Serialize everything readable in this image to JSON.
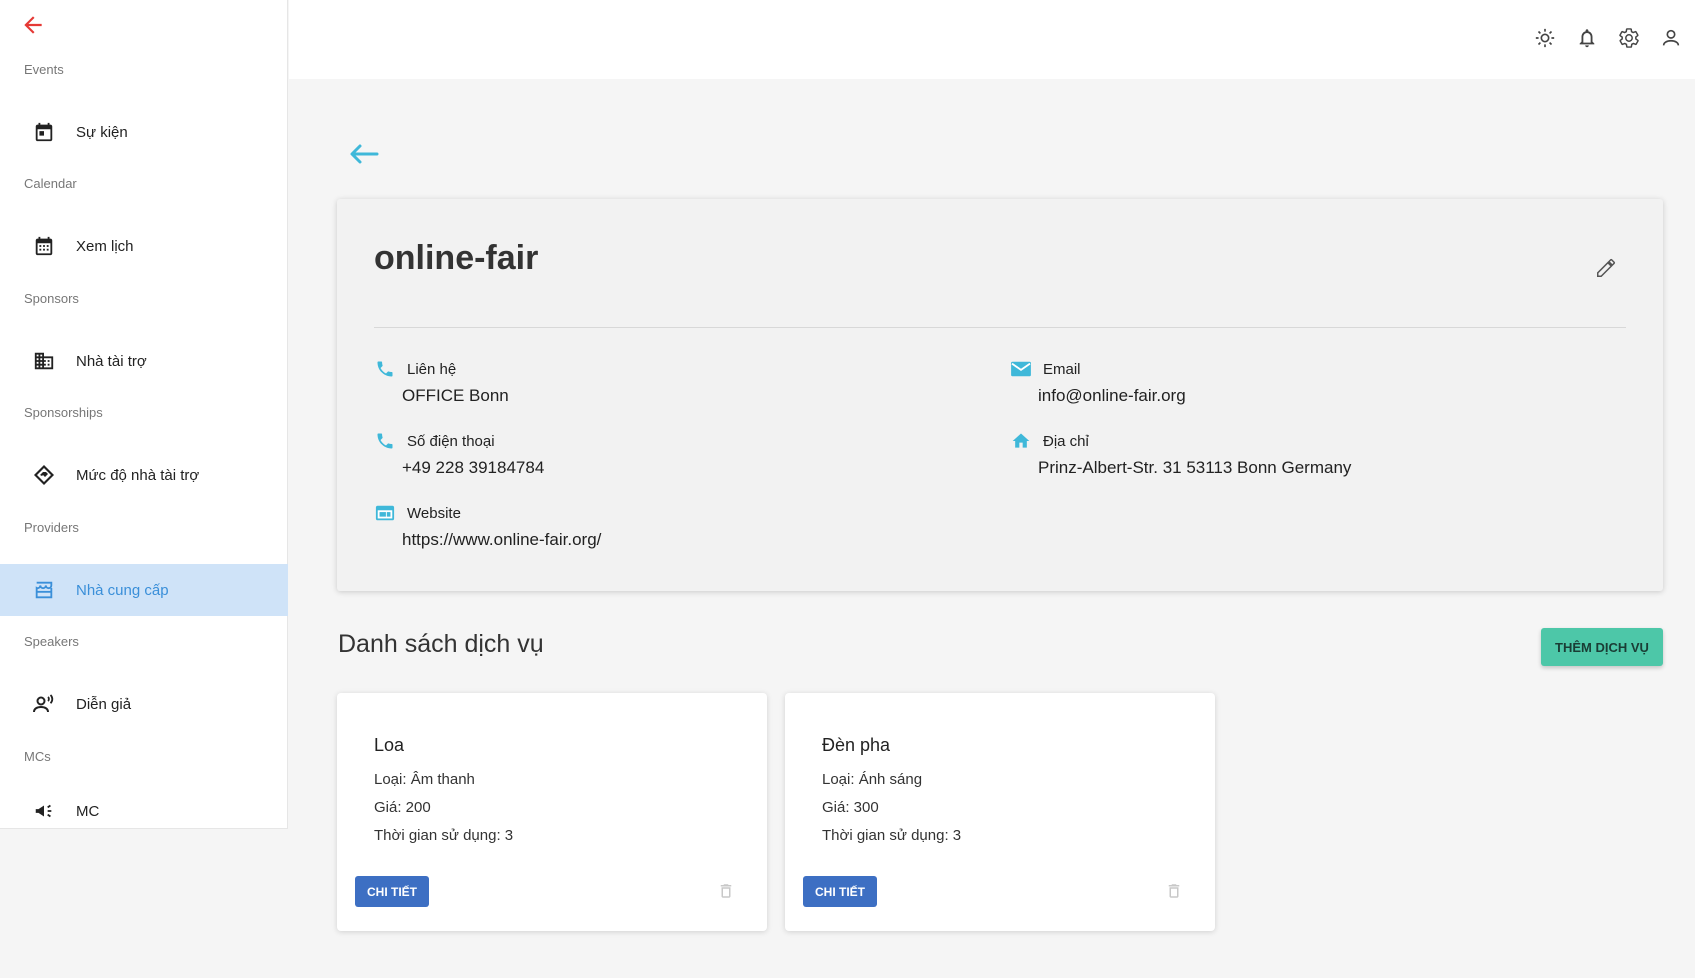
{
  "sidebar": {
    "groups": [
      {
        "title": "Events",
        "item": "Sự kiện",
        "icon": "calendar-day-icon"
      },
      {
        "title": "Calendar",
        "item": "Xem lịch",
        "icon": "calendar-grid-icon"
      },
      {
        "title": "Sponsors",
        "item": "Nhà tài trợ",
        "icon": "building-icon"
      },
      {
        "title": "Sponsorships",
        "item": "Mức độ nhà tài trợ",
        "icon": "handshake-icon"
      },
      {
        "title": "Providers",
        "item": "Nhà cung cấp",
        "icon": "store-icon"
      },
      {
        "title": "Speakers",
        "item": "Diễn giả",
        "icon": "speaker-icon"
      },
      {
        "title": "MCs",
        "item": "MC",
        "icon": "megaphone-icon"
      }
    ],
    "active": "Nhà cung cấp"
  },
  "topbar": {
    "icons": [
      "sun-icon",
      "bell-icon",
      "gear-icon",
      "user-icon"
    ]
  },
  "provider": {
    "name": "online-fair",
    "contact_label": "Liên hệ",
    "contact_value": "OFFICE Bonn",
    "phone_label": "Số điện thoại",
    "phone_value": "+49 228 39184784",
    "website_label": "Website",
    "website_value": "https://www.online-fair.org/",
    "email_label": "Email",
    "email_value": "info@online-fair.org",
    "address_label": "Địa chỉ",
    "address_value": "Prinz-Albert-Str. 31 53113 Bonn Germany"
  },
  "services": {
    "title": "Danh sách dịch vụ",
    "add_label": "THÊM DỊCH VỤ",
    "items": [
      {
        "name": "Loa",
        "type": "Loại: Âm thanh",
        "price": "Giá: 200",
        "duration": "Thời gian sử dụng: 3",
        "detail_label": "CHI TIẾT"
      },
      {
        "name": "Đèn pha",
        "type": "Loại: Ánh sáng",
        "price": "Giá: 300",
        "duration": "Thời gian sử dụng: 3",
        "detail_label": "CHI TIẾT"
      }
    ]
  },
  "colors": {
    "accent": "#4dc7a8",
    "primary_button": "#3d6fc3",
    "icon_teal": "#3fb8d9",
    "active_bg": "#cfe3f8",
    "back_red": "#e53935"
  }
}
